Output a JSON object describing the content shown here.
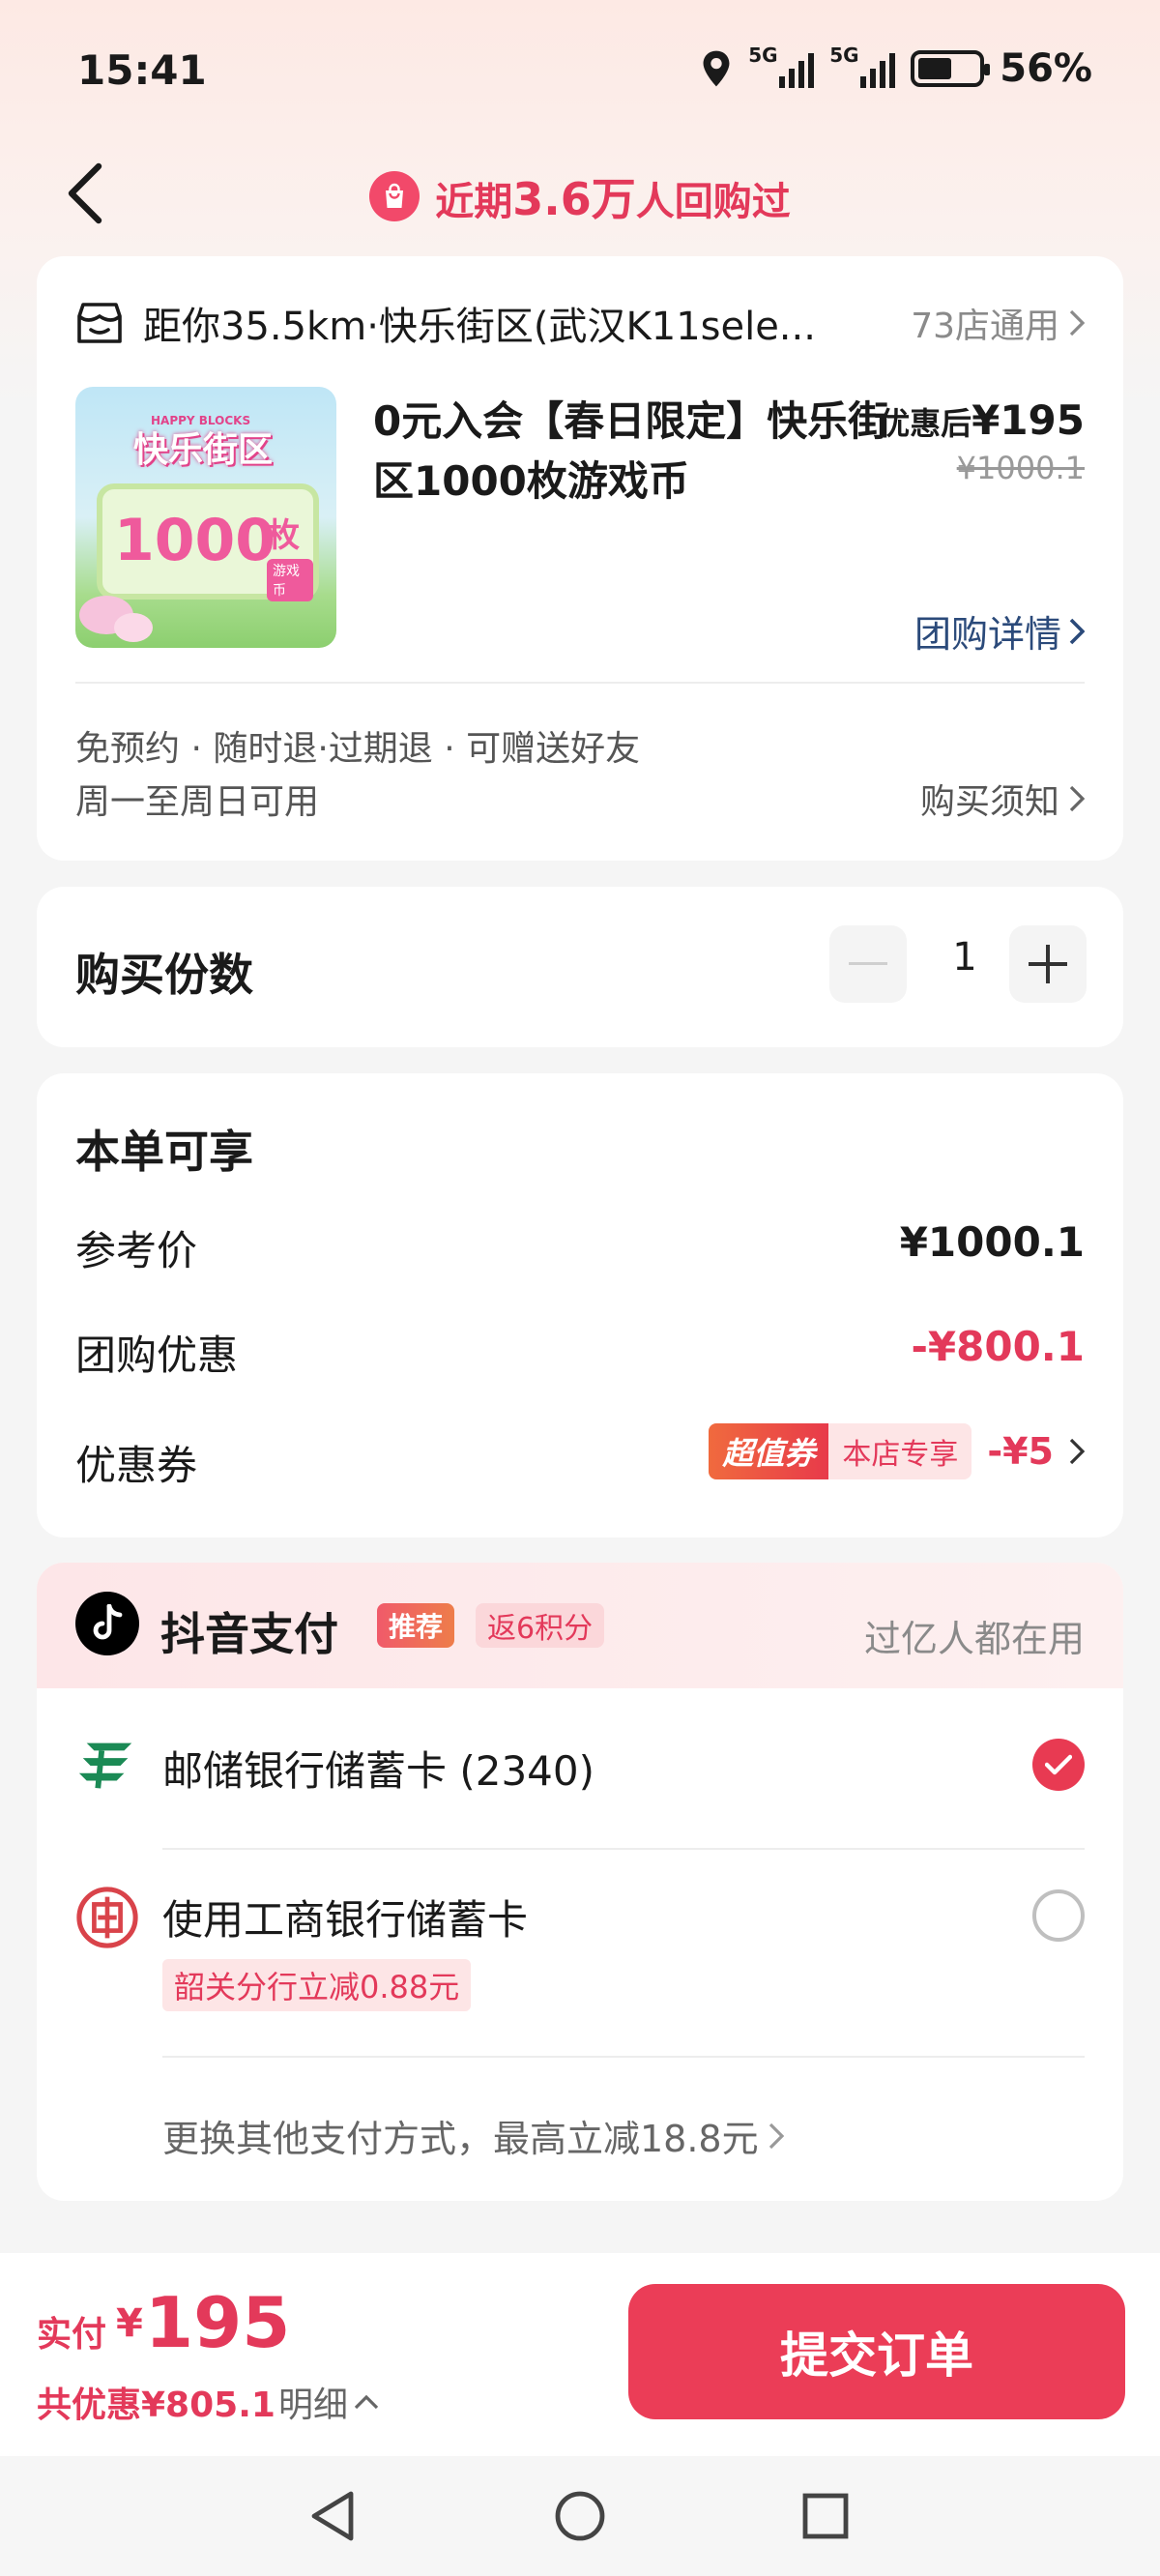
{
  "status_bar": {
    "time": "15:41",
    "net1": "5G",
    "net2": "5G",
    "battery": "56%"
  },
  "nav": {
    "title_prefix": "近期",
    "title_num": "3.6万",
    "title_suffix": "人回购过"
  },
  "product": {
    "store": "距你35.5km·快乐街区(武汉K11sele...",
    "store_count": "73店通用",
    "image_brand": "快乐街区",
    "image_brand_sub": "HAPPY BLOCKS",
    "image_number": "1000",
    "image_unit": "枚",
    "image_tag": "游戏币",
    "title": "0元入会【春日限定】快乐街区1000枚游戏币",
    "price_label": "优惠后",
    "price": "¥195",
    "orig_price": "¥1000.1",
    "group_detail": "团购详情",
    "rules_line1": "免预约 · 随时退·过期退 · 可赠送好友",
    "rules_line2": "周一至周日可用",
    "buy_notice": "购买须知"
  },
  "quantity": {
    "label": "购买份数",
    "value": "1"
  },
  "benefits": {
    "title": "本单可享",
    "ref_label": "参考价",
    "ref_value": "¥1000.1",
    "group_label": "团购优惠",
    "group_value": "-¥800.1",
    "coupon_label": "优惠券",
    "coupon_badge_left": "超值券",
    "coupon_badge_right": "本店专享",
    "coupon_value": "-¥5"
  },
  "payment": {
    "title": "抖音支付",
    "recommend": "推荐",
    "points": "返6积分",
    "hint": "过亿人都在用",
    "option1": "邮储银行储蓄卡 (2340)",
    "option2": "使用工商银行储蓄卡",
    "option2_tag": "韶关分行立减0.88元",
    "other": "更换其他支付方式，最高立减18.8元"
  },
  "bottom": {
    "paid_label": "实付",
    "paid_yen": "¥",
    "paid_amount": "195",
    "saved": "共优惠¥805.1",
    "detail": "明细",
    "submit": "提交订单"
  },
  "colors": {
    "accent": "#eb3d57",
    "link": "#2b4a7a"
  }
}
